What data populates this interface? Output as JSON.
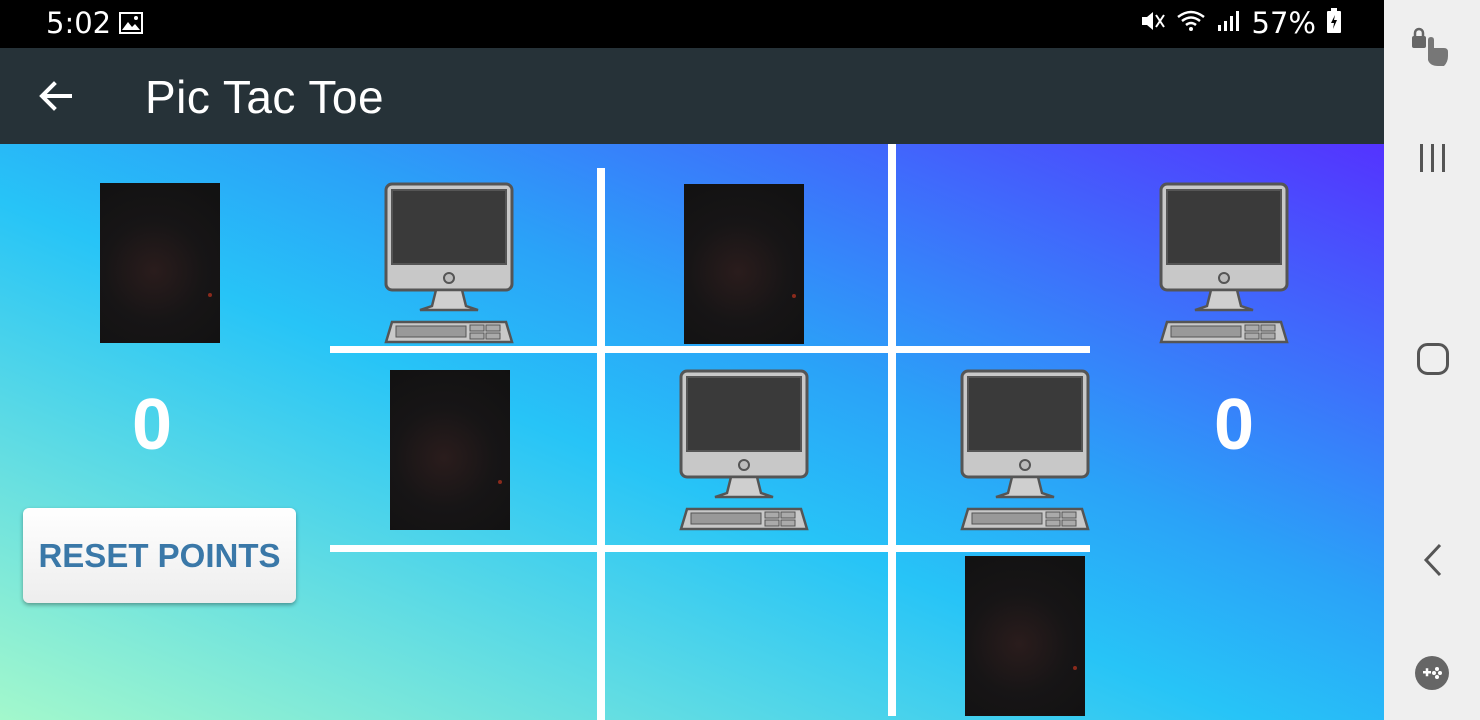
{
  "status_bar": {
    "time": "5:02",
    "battery": "57%",
    "icons": [
      "gallery-icon",
      "mute-icon",
      "wifi-icon",
      "signal-icon",
      "battery-icon"
    ]
  },
  "app_bar": {
    "title": "Pic Tac Toe",
    "back_icon": "arrow-left-icon"
  },
  "scores": {
    "left": "0",
    "right": "0"
  },
  "reset_button": {
    "label": "RESET POINTS"
  },
  "board": [
    [
      "computer",
      "photo",
      ""
    ],
    [
      "photo",
      "computer",
      "computer"
    ],
    [
      "",
      "",
      "photo"
    ]
  ],
  "nav_bar": {
    "icons": [
      "screen-lock-touch-icon",
      "recent-apps-icon",
      "home-icon",
      "back-icon",
      "game-launcher-icon"
    ]
  },
  "colors": {
    "app_bar": "#263238",
    "reset_text": "#3a78a8",
    "grid_line": "#ffffff"
  }
}
